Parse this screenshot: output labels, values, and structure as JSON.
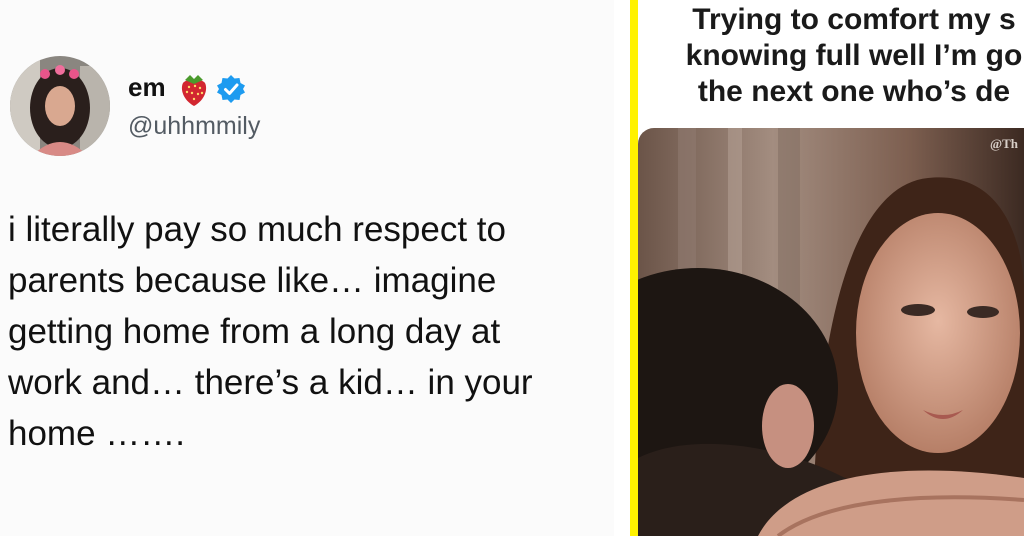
{
  "tweet": {
    "display_name": "em",
    "emoji_icon": "strawberry-emoji",
    "badge_icon": "verified-badge-icon",
    "handle": "@uhhmmily",
    "text": "i literally pay so much respect to\nparents because like… imagine\ngetting home from a long day at\nwork and… there’s a kid… in your\nhome …….",
    "colors": {
      "verified": "#1d9bf0",
      "name": "#111111",
      "handle": "#535b63"
    }
  },
  "meme": {
    "caption": "Trying to comfort my s\nknowing full well I’m go\nthe next one who’s de",
    "watermark": "@Th",
    "border_color": "#fff200"
  }
}
